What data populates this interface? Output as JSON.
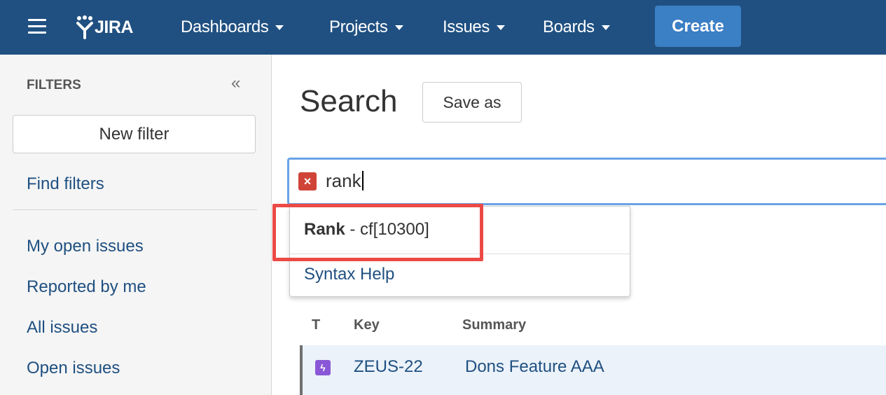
{
  "header": {
    "logo_text": "JIRA",
    "nav": [
      {
        "label": "Dashboards"
      },
      {
        "label": "Projects"
      },
      {
        "label": "Issues"
      },
      {
        "label": "Boards"
      }
    ],
    "create_label": "Create",
    "bg_color": "#205081",
    "create_color": "#3b7fc4"
  },
  "sidebar": {
    "heading": "FILTERS",
    "collapse_glyph": "«",
    "new_filter_label": "New filter",
    "find_filters_label": "Find filters",
    "items": [
      {
        "label": "My open issues"
      },
      {
        "label": "Reported by me"
      },
      {
        "label": "All issues"
      },
      {
        "label": "Open issues"
      }
    ]
  },
  "main": {
    "title": "Search",
    "save_as_label": "Save as",
    "search": {
      "clear_icon": "close-icon",
      "query": "rank"
    },
    "autocomplete": {
      "suggestion_bold": "Rank",
      "suggestion_rest": " - cf[10300]",
      "syntax_help": "Syntax Help",
      "highlight_color": "#ec4a45"
    },
    "table": {
      "columns": [
        "T",
        "Key",
        "Summary"
      ],
      "rows": [
        {
          "type_icon": "new-feature-icon",
          "key": "ZEUS-22",
          "summary": "Dons Feature AAA"
        }
      ]
    }
  }
}
